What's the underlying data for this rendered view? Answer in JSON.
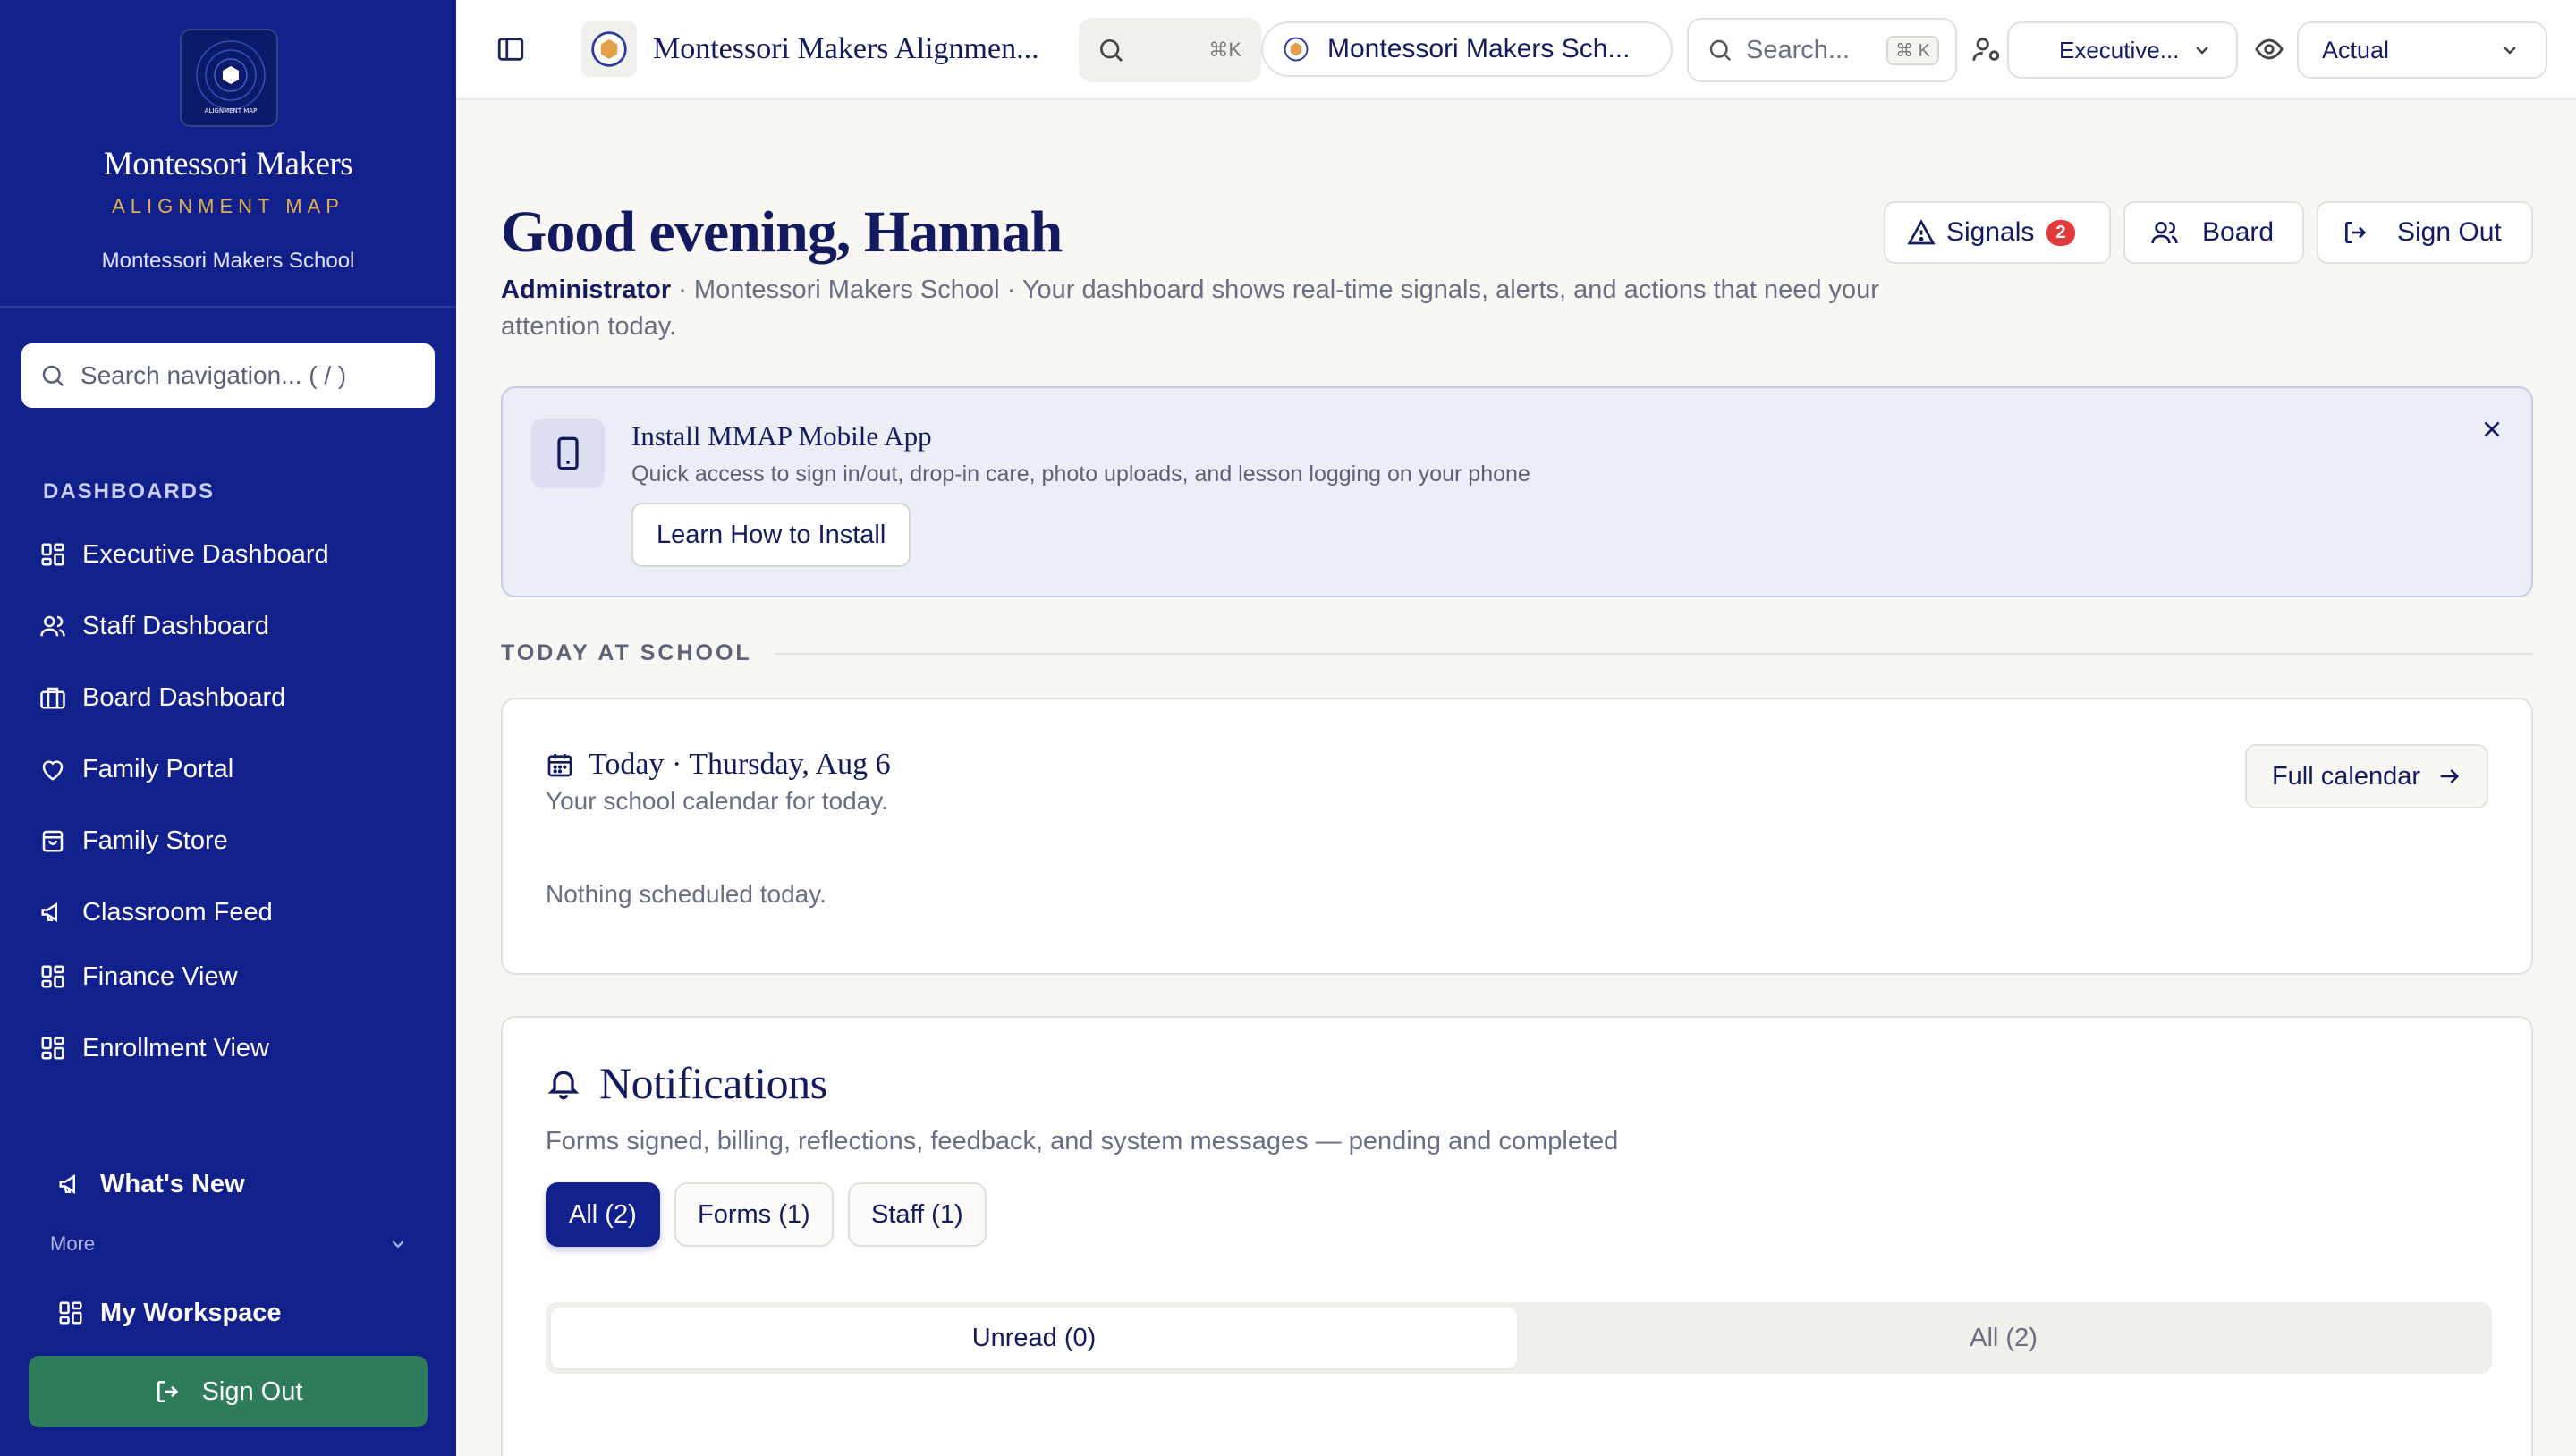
{
  "brand": {
    "title": "Montessori Makers",
    "subtitle": "ALIGNMENT MAP",
    "school": "Montessori Makers School",
    "logo_caption": "ALIGNMENT MAP"
  },
  "sidebar": {
    "search_placeholder": "Search navigation... ( / )",
    "section_label": "DASHBOARDS",
    "items": [
      {
        "label": "Executive Dashboard",
        "icon": "grid-icon"
      },
      {
        "label": "Staff Dashboard",
        "icon": "users-icon"
      },
      {
        "label": "Board Dashboard",
        "icon": "briefcase-icon"
      },
      {
        "label": "Family Portal",
        "icon": "heart-icon"
      },
      {
        "label": "Family Store",
        "icon": "shopping-bag-icon"
      },
      {
        "label": "Classroom Feed",
        "icon": "megaphone-icon"
      },
      {
        "label": "Finance View",
        "icon": "grid-icon"
      },
      {
        "label": "Enrollment View",
        "icon": "grid-icon"
      }
    ],
    "whats_new": "What's New",
    "more_label": "More",
    "my_workspace": "My Workspace",
    "sign_out": "Sign Out"
  },
  "topbar": {
    "app_title": "Montessori Makers Alignmen...",
    "shortcut_1": "⌘K",
    "school_selector": "Montessori Makers Sch...",
    "search_placeholder": "Search...",
    "search_shortcut": "⌘ K",
    "view_select": "Executive...",
    "mode_select": "Actual"
  },
  "header": {
    "greeting": "Good evening, Hannah",
    "role": "Administrator",
    "description": " · Montessori Makers School · Your dashboard shows real-time signals, alerts, and actions that need your attention today.",
    "signals_label": "Signals",
    "signals_count": "2",
    "board_label": "Board",
    "sign_out_label": "Sign Out"
  },
  "banner": {
    "title": "Install MMAP Mobile App",
    "text": "Quick access to sign in/out, drop-in care, photo uploads, and lesson logging on your phone",
    "button": "Learn How to Install"
  },
  "today_section": {
    "heading": "TODAY AT SCHOOL",
    "title": "Today · Thursday, Aug 6",
    "subtitle": "Your school calendar for today.",
    "empty": "Nothing scheduled today.",
    "full_calendar": "Full calendar"
  },
  "notifications": {
    "title": "Notifications",
    "subtitle": "Forms signed, billing, reflections, feedback, and system messages — pending and completed",
    "filters": [
      "All (2)",
      "Forms (1)",
      "Staff (1)"
    ],
    "tabs": [
      "Unread (0)",
      "All (2)"
    ]
  },
  "colors": {
    "sidebar": "#11208b",
    "accent_gold": "#e2b04a",
    "signout_green": "#2e7c5a",
    "badge_red": "#e33b3b",
    "background": "#f8f7f4"
  }
}
